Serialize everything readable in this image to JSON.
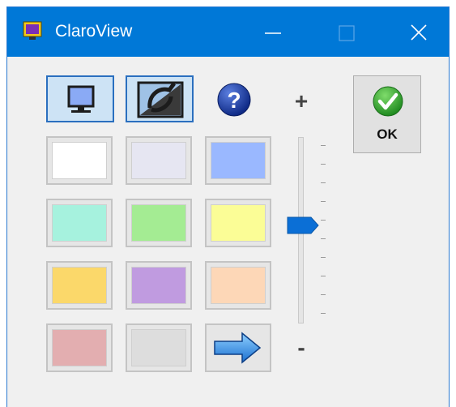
{
  "window": {
    "title": "ClaroView",
    "controls": {
      "minimize": "minimize",
      "maximize": "maximize",
      "close": "close"
    }
  },
  "toolbar": {
    "monitor_icon": "monitor-icon",
    "screen_tint_icon": "screen-tint-icon",
    "help_icon": "help-icon"
  },
  "slider": {
    "plus_label": "+",
    "minus_label": "-",
    "tick_count": 10,
    "value_fraction": 0.52
  },
  "ok_button": {
    "label": "OK",
    "icon": "checkmark-icon"
  },
  "swatches": [
    {
      "name": "white",
      "color": "#ffffff",
      "selected": true
    },
    {
      "name": "lavender-grey",
      "color": "#e6e6f2"
    },
    {
      "name": "light-blue",
      "color": "#9ab8ff"
    },
    {
      "name": "mint",
      "color": "#a6f2de"
    },
    {
      "name": "light-green",
      "color": "#a4ec93"
    },
    {
      "name": "light-yellow",
      "color": "#fbfd96"
    },
    {
      "name": "light-orange",
      "color": "#fbd86a"
    },
    {
      "name": "light-purple",
      "color": "#c09be0"
    },
    {
      "name": "peach",
      "color": "#fdd7b7"
    },
    {
      "name": "light-red",
      "color": "#e3aeb0"
    },
    {
      "name": "light-grey",
      "color": "#dddddd"
    }
  ],
  "next_icon": "arrow-right-icon",
  "colors": {
    "titlebar": "#0078d7",
    "accent": "#2a6fbf",
    "ok_green": "#39a935"
  }
}
